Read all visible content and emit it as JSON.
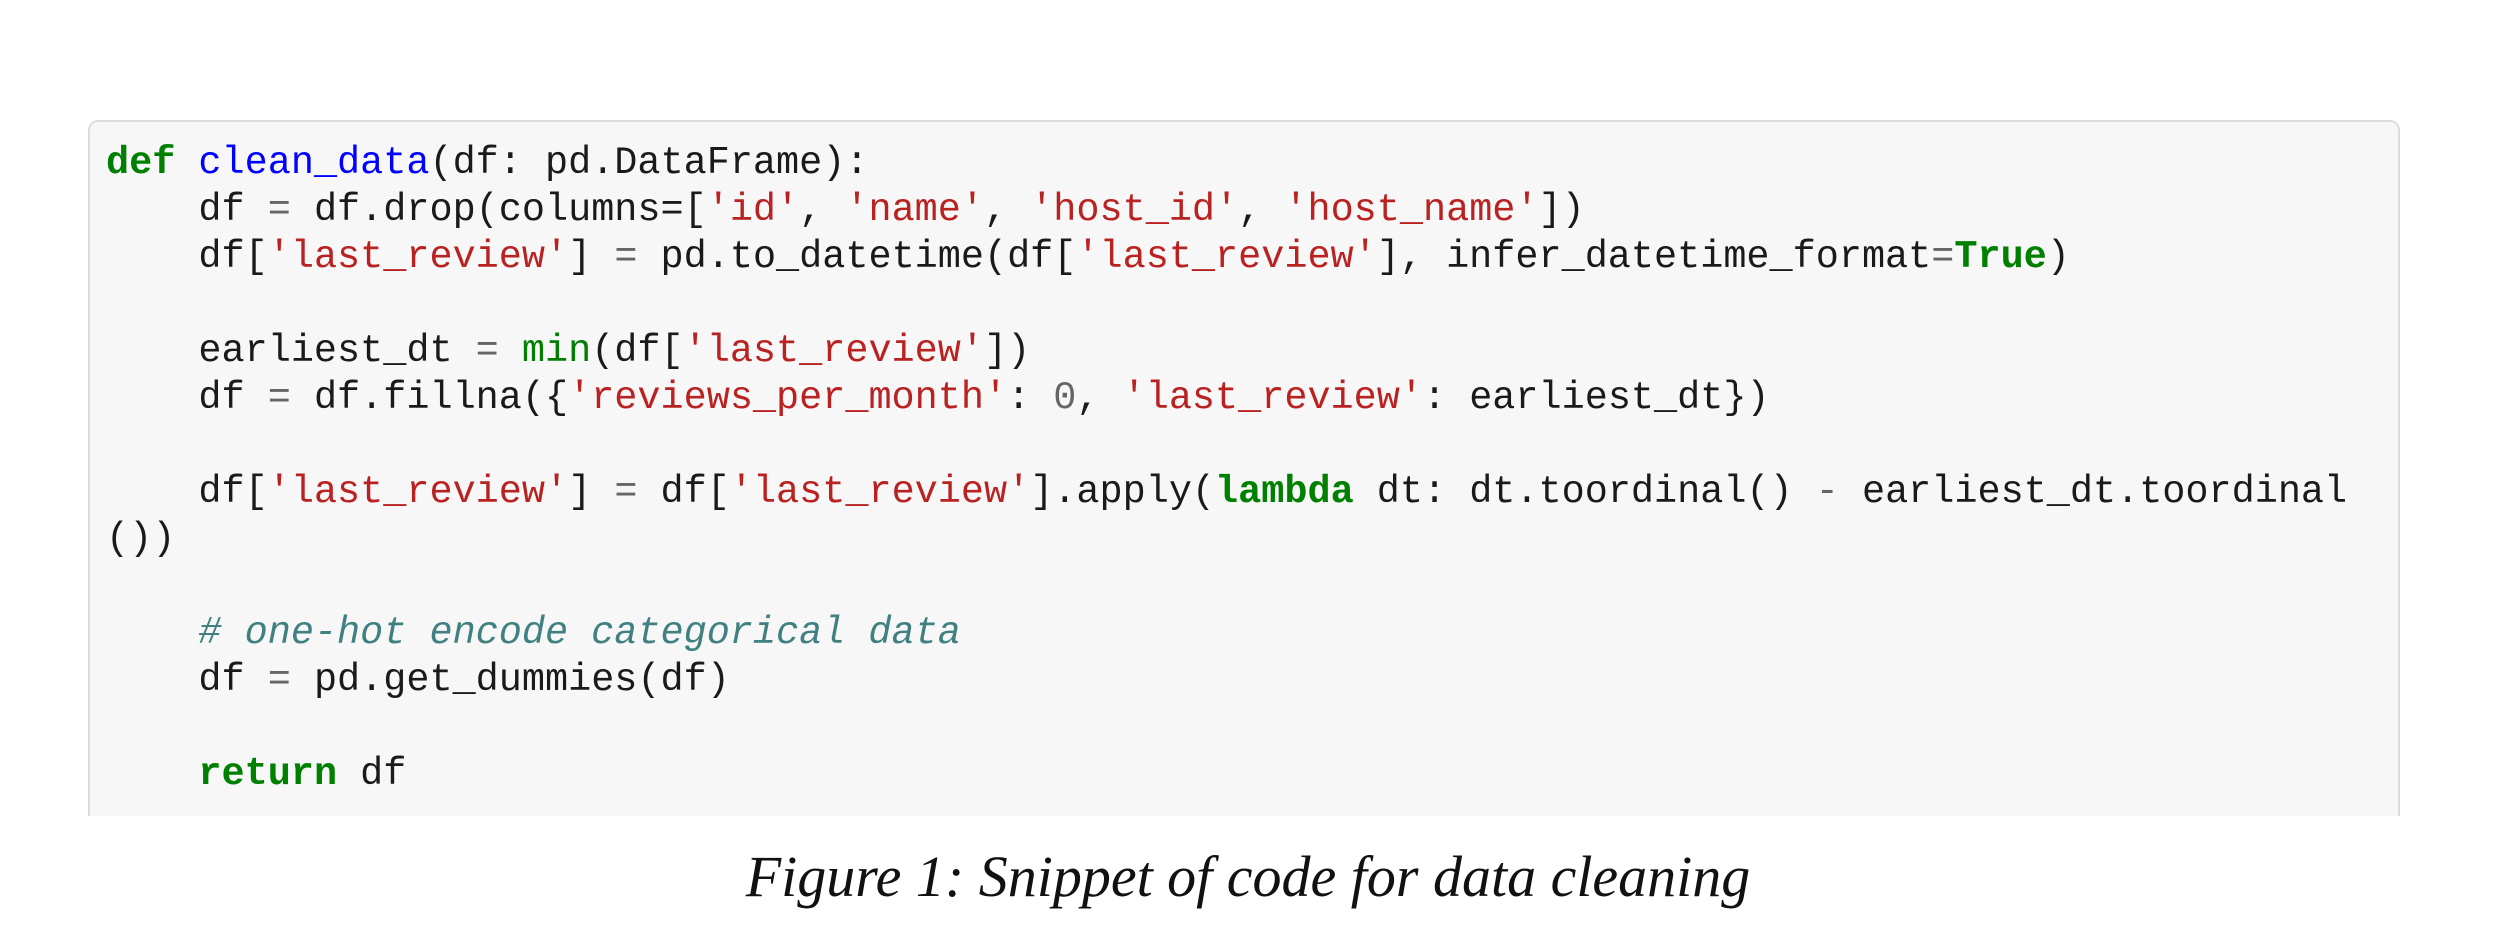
{
  "code_lines": [
    [
      {
        "t": "def",
        "c": "kw"
      },
      {
        "t": " ",
        "c": ""
      },
      {
        "t": "clean_data",
        "c": "fn"
      },
      {
        "t": "(df: pd.DataFrame):",
        "c": ""
      }
    ],
    [
      {
        "t": "    df ",
        "c": ""
      },
      {
        "t": "=",
        "c": "op"
      },
      {
        "t": " df.drop(columns=[",
        "c": ""
      },
      {
        "t": "'id'",
        "c": "str"
      },
      {
        "t": ", ",
        "c": ""
      },
      {
        "t": "'name'",
        "c": "str"
      },
      {
        "t": ", ",
        "c": ""
      },
      {
        "t": "'host_id'",
        "c": "str"
      },
      {
        "t": ", ",
        "c": ""
      },
      {
        "t": "'host_name'",
        "c": "str"
      },
      {
        "t": "])",
        "c": ""
      }
    ],
    [
      {
        "t": "    df[",
        "c": ""
      },
      {
        "t": "'last_review'",
        "c": "str"
      },
      {
        "t": "] ",
        "c": ""
      },
      {
        "t": "=",
        "c": "op"
      },
      {
        "t": " pd.to_datetime(df[",
        "c": ""
      },
      {
        "t": "'last_review'",
        "c": "str"
      },
      {
        "t": "], infer_datetime_format",
        "c": ""
      },
      {
        "t": "=",
        "c": "op"
      },
      {
        "t": "True",
        "c": "kw"
      },
      {
        "t": ")",
        "c": ""
      }
    ],
    [],
    [
      {
        "t": "    earliest_dt ",
        "c": ""
      },
      {
        "t": "=",
        "c": "op"
      },
      {
        "t": " ",
        "c": ""
      },
      {
        "t": "min",
        "c": "bi"
      },
      {
        "t": "(df[",
        "c": ""
      },
      {
        "t": "'last_review'",
        "c": "str"
      },
      {
        "t": "])",
        "c": ""
      }
    ],
    [
      {
        "t": "    df ",
        "c": ""
      },
      {
        "t": "=",
        "c": "op"
      },
      {
        "t": " df.fillna({",
        "c": ""
      },
      {
        "t": "'reviews_per_month'",
        "c": "str"
      },
      {
        "t": ": ",
        "c": ""
      },
      {
        "t": "0",
        "c": "num"
      },
      {
        "t": ", ",
        "c": ""
      },
      {
        "t": "'last_review'",
        "c": "str"
      },
      {
        "t": ": earliest_dt})",
        "c": ""
      }
    ],
    [],
    [
      {
        "t": "    df[",
        "c": ""
      },
      {
        "t": "'last_review'",
        "c": "str"
      },
      {
        "t": "] ",
        "c": ""
      },
      {
        "t": "=",
        "c": "op"
      },
      {
        "t": " df[",
        "c": ""
      },
      {
        "t": "'last_review'",
        "c": "str"
      },
      {
        "t": "].apply(",
        "c": ""
      },
      {
        "t": "lambda",
        "c": "kw"
      },
      {
        "t": " dt: dt.toordinal() ",
        "c": ""
      },
      {
        "t": "-",
        "c": "op"
      },
      {
        "t": " earliest_dt.toordinal",
        "c": ""
      }
    ],
    [
      {
        "t": "())",
        "c": ""
      }
    ],
    [],
    [
      {
        "t": "    ",
        "c": ""
      },
      {
        "t": "# one-hot encode categorical data",
        "c": "cm"
      }
    ],
    [
      {
        "t": "    df ",
        "c": ""
      },
      {
        "t": "=",
        "c": "op"
      },
      {
        "t": " pd.get_dummies(df)",
        "c": ""
      }
    ],
    [],
    [
      {
        "t": "    ",
        "c": ""
      },
      {
        "t": "return",
        "c": "kw"
      },
      {
        "t": " df",
        "c": ""
      }
    ]
  ],
  "caption": "Figure 1: Snippet of code for data cleaning"
}
